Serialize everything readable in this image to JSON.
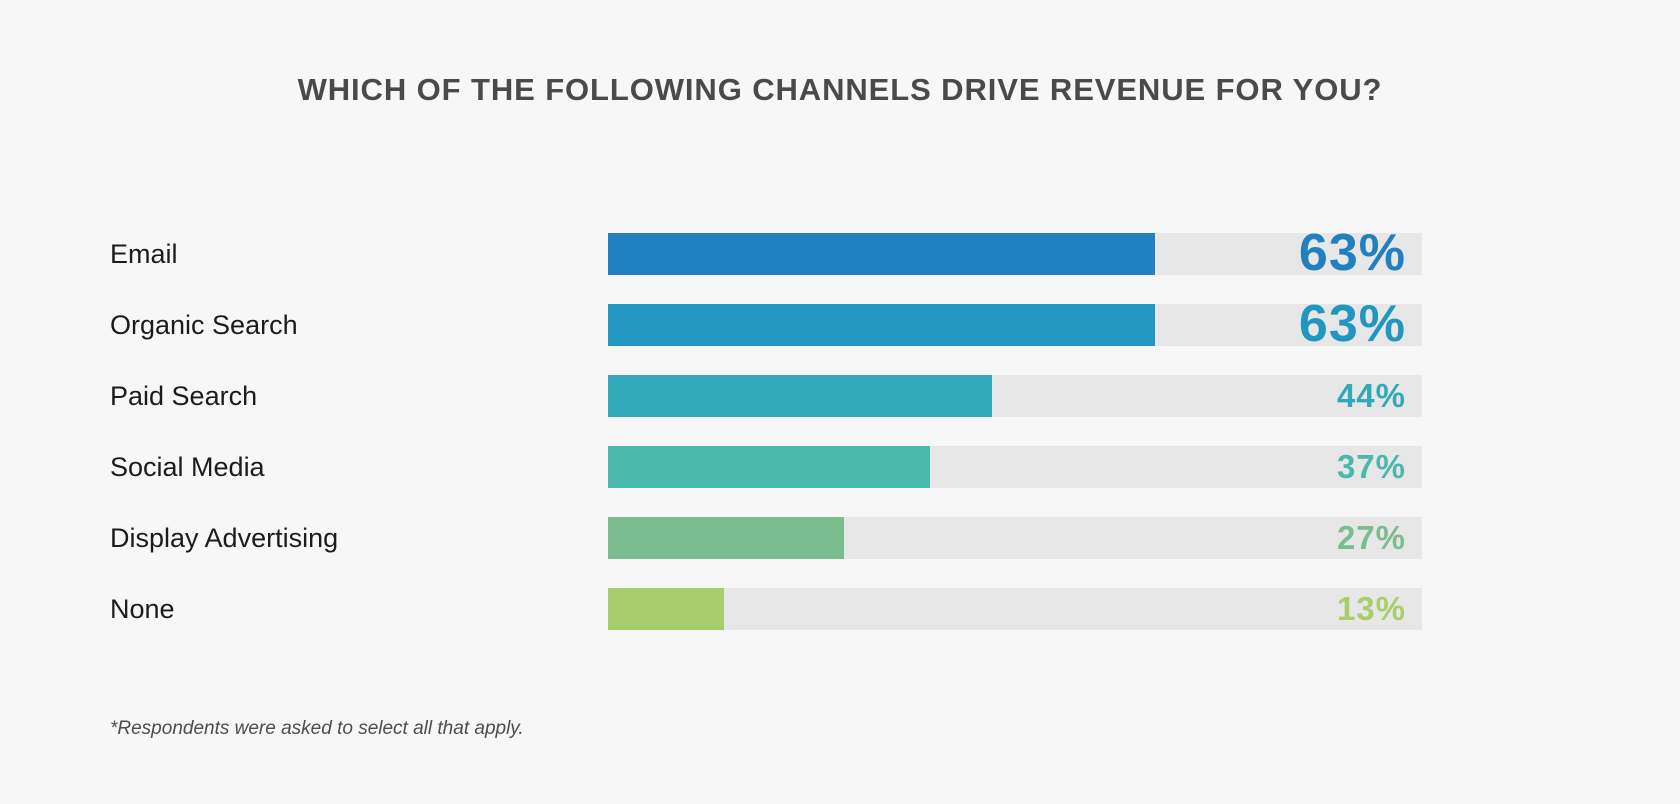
{
  "chart_data": {
    "type": "bar",
    "orientation": "horizontal",
    "title": "WHICH OF THE FOLLOWING CHANNELS DRIVE REVENUE FOR YOU?",
    "xlabel": "",
    "ylabel": "",
    "xlim": [
      0,
      100
    ],
    "grid": false,
    "legend": null,
    "value_suffix": "%",
    "track_max_percent": 100,
    "categories": [
      "Email",
      "Organic Search",
      "Paid Search",
      "Social Media",
      "Display Advertising",
      "None"
    ],
    "values": [
      63,
      63,
      44,
      37,
      27,
      13
    ],
    "value_labels": [
      "63%",
      "63%",
      "44%",
      "37%",
      "27%",
      "13%"
    ],
    "bar_colors": [
      "#2180c0",
      "#2196bf",
      "#31a9b8",
      "#4bb8ae",
      "#7cbd90",
      "#a8cd6c"
    ],
    "track_color": "#e7e7e7",
    "background_color": "#f7f7f7",
    "title_color": "#4a4a4c",
    "label_color": "#1c1c1c",
    "annotation": "*Respondents were asked to select all that apply.",
    "bars": [
      {
        "category": "Email",
        "value": 63,
        "label": "63%",
        "color": "#2180c0",
        "fill_fraction": 0.672,
        "emphasis": "big"
      },
      {
        "category": "Organic Search",
        "value": 63,
        "label": "63%",
        "color": "#2196bf",
        "fill_fraction": 0.672,
        "emphasis": "big"
      },
      {
        "category": "Paid Search",
        "value": 44,
        "label": "44%",
        "color": "#31a9b8",
        "fill_fraction": 0.472,
        "emphasis": "small"
      },
      {
        "category": "Social Media",
        "value": 37,
        "label": "37%",
        "color": "#4bb8ae",
        "fill_fraction": 0.395,
        "emphasis": "small"
      },
      {
        "category": "Display Advertising",
        "value": 27,
        "label": "27%",
        "color": "#7cbd90",
        "fill_fraction": 0.29,
        "emphasis": "small"
      },
      {
        "category": "None",
        "value": 13,
        "label": "13%",
        "color": "#a8cd6c",
        "fill_fraction": 0.142,
        "emphasis": "small"
      }
    ]
  }
}
